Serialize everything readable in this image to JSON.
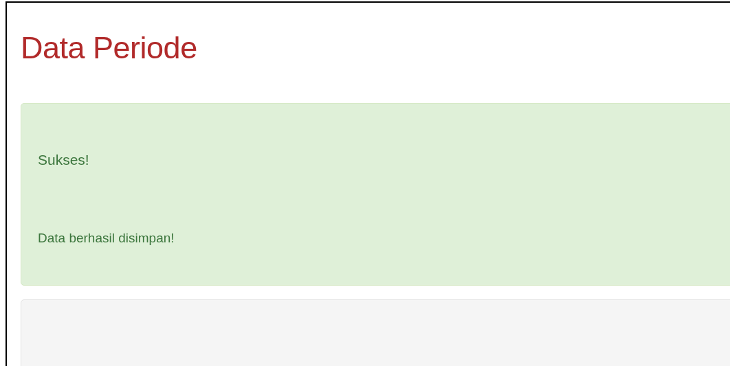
{
  "page": {
    "title": "Data Periode"
  },
  "alert": {
    "kind": "success",
    "heading": "Sukses!",
    "message": "Data berhasil disimpan!"
  }
}
